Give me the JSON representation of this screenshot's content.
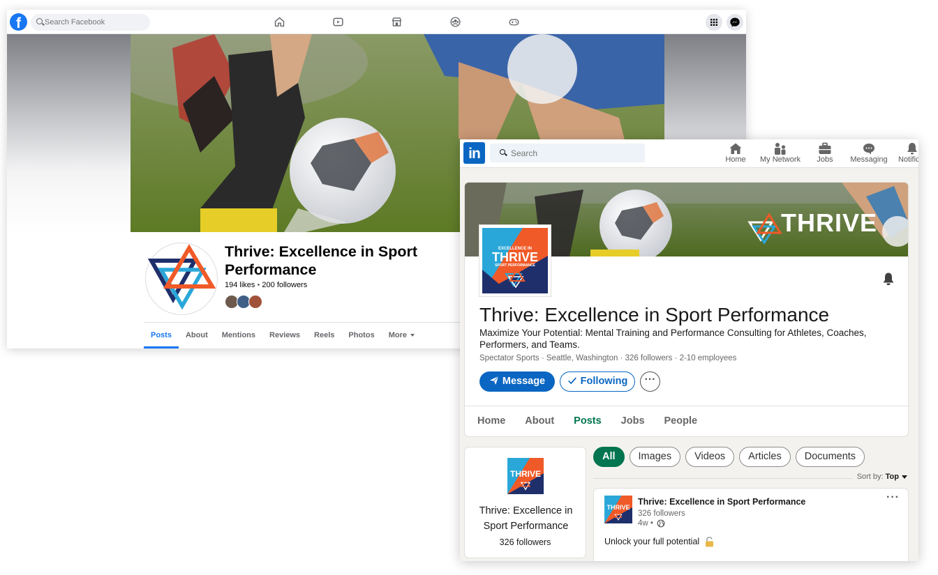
{
  "colors": {
    "facebook_blue": "#1877f2",
    "linkedin_blue": "#0a66c2",
    "linkedin_green": "#01754f",
    "thrive_orange": "#f05a28",
    "thrive_navy": "#1e2f6b",
    "thrive_cyan": "#2aa7d9"
  },
  "facebook": {
    "logo_letter": "f",
    "search": {
      "placeholder": "Search Facebook"
    },
    "nav_icons": [
      "home-icon",
      "video-icon",
      "marketplace-icon",
      "groups-icon",
      "gaming-icon"
    ],
    "right_icons": [
      "apps-grid-icon",
      "messenger-icon"
    ],
    "page": {
      "name": "Thrive: Excellence in Sport Performance",
      "likes": "194 likes",
      "separator": "•",
      "followers": "200 followers"
    },
    "tabs": [
      {
        "label": "Posts",
        "active": true
      },
      {
        "label": "About"
      },
      {
        "label": "Mentions"
      },
      {
        "label": "Reviews"
      },
      {
        "label": "Reels"
      },
      {
        "label": "Photos"
      },
      {
        "label": "More"
      }
    ]
  },
  "linkedin": {
    "logo_text": "in",
    "search": {
      "placeholder": "Search"
    },
    "nav": [
      {
        "label": "Home",
        "icon": "home-icon"
      },
      {
        "label": "My Network",
        "icon": "network-icon"
      },
      {
        "label": "Jobs",
        "icon": "jobs-icon"
      },
      {
        "label": "Messaging",
        "icon": "messaging-icon"
      },
      {
        "label": "Notifications",
        "icon": "bell-icon"
      }
    ],
    "banner_text": "THRIVE",
    "logo_tile": {
      "line1": "EXCELLENCE IN",
      "line2": "THRIVE",
      "line3": "SPORT PERFORMANCE"
    },
    "company": {
      "name": "Thrive: Excellence in Sport Performance",
      "tagline": "Maximize Your Potential: Mental Training and Performance Consulting for Athletes, Coaches, Performers, and Teams.",
      "meta": "Spectator Sports · Seattle, Washington · 326 followers · 2-10 employees"
    },
    "buttons": {
      "message": "Message",
      "following": "Following",
      "more": "···"
    },
    "tabs": [
      {
        "label": "Home"
      },
      {
        "label": "About"
      },
      {
        "label": "Posts",
        "active": true
      },
      {
        "label": "Jobs"
      },
      {
        "label": "People"
      }
    ],
    "sidebar": {
      "name": "Thrive: Excellence in Sport Performance",
      "followers": "326 followers"
    },
    "filters": [
      {
        "label": "All",
        "active": true
      },
      {
        "label": "Images"
      },
      {
        "label": "Videos"
      },
      {
        "label": "Articles"
      },
      {
        "label": "Documents"
      }
    ],
    "sort": {
      "label": "Sort by:",
      "value": "Top"
    },
    "post": {
      "author": "Thrive: Excellence in Sport Performance",
      "followers": "326 followers",
      "age": "4w •",
      "menu": "···",
      "text": "Unlock your full potential"
    }
  }
}
